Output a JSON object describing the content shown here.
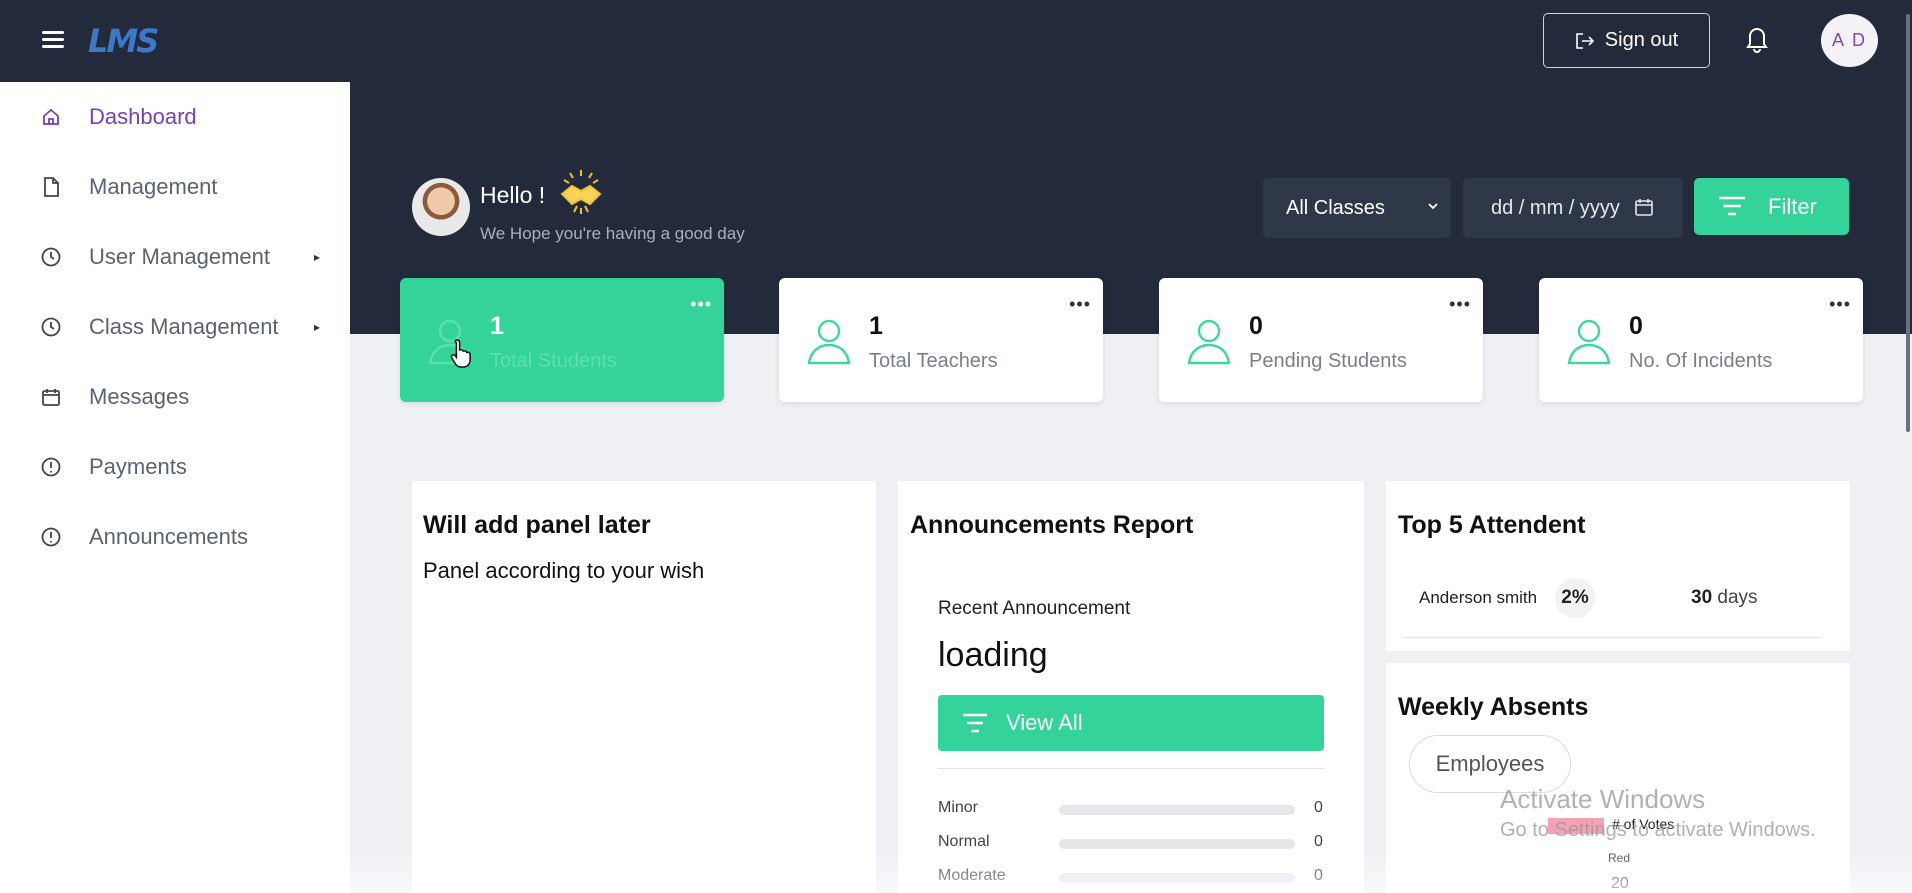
{
  "app": {
    "logo_text": "LMS"
  },
  "header": {
    "signout_label": "Sign out",
    "avatar_initials": "A D"
  },
  "sidebar": {
    "items": [
      {
        "label": "Dashboard",
        "icon": "home-icon",
        "active": true,
        "has_submenu": false
      },
      {
        "label": "Management",
        "icon": "file-icon",
        "active": false,
        "has_submenu": false
      },
      {
        "label": "User Management",
        "icon": "clock-icon",
        "active": false,
        "has_submenu": true
      },
      {
        "label": "Class Management",
        "icon": "clock-icon",
        "active": false,
        "has_submenu": true
      },
      {
        "label": "Messages",
        "icon": "calendar-icon",
        "active": false,
        "has_submenu": false
      },
      {
        "label": "Payments",
        "icon": "alert-circle-icon",
        "active": false,
        "has_submenu": false
      },
      {
        "label": "Announcements",
        "icon": "alert-circle-icon",
        "active": false,
        "has_submenu": false
      }
    ]
  },
  "greeting": {
    "hello": "Hello !",
    "subtitle": "We Hope you're having a good day"
  },
  "filters": {
    "classes_selected": "All Classes",
    "date_placeholder": "dd / mm / yyyy",
    "filter_label": "Filter"
  },
  "stats": [
    {
      "value": "1",
      "label": "Total Students",
      "active": true
    },
    {
      "value": "1",
      "label": "Total Teachers",
      "active": false
    },
    {
      "value": "0",
      "label": "Pending Students",
      "active": false
    },
    {
      "value": "0",
      "label": "No. Of Incidents",
      "active": false
    }
  ],
  "panel_later": {
    "title": "Will add panel later",
    "subtitle": "Panel according to your wish"
  },
  "announcements": {
    "title": "Announcements Report",
    "recent_label": "Recent Announcement",
    "recent_value": "loading",
    "view_all_label": "View All",
    "severities": [
      {
        "label": "Minor",
        "value": "0"
      },
      {
        "label": "Normal",
        "value": "0"
      },
      {
        "label": "Moderate",
        "value": "0"
      }
    ]
  },
  "top_attendent": {
    "title": "Top 5 Attendent",
    "rows": [
      {
        "name": "Anderson smith",
        "percent": "2%",
        "days_value": "30",
        "days_unit": "days"
      }
    ]
  },
  "weekly_absents": {
    "title": "Weekly Absents",
    "filter_chip": "Employees",
    "legend_label": "# of Votes",
    "category_label": "Red",
    "value_label": "20",
    "colors": {
      "series": "#f5a3b3"
    }
  },
  "watermark": {
    "line1": "Activate Windows",
    "line2": "Go to Settings to activate Windows."
  },
  "colors": {
    "navy": "#232a3c",
    "accent_green": "#34d399",
    "active_purple": "#7a3fb0"
  }
}
